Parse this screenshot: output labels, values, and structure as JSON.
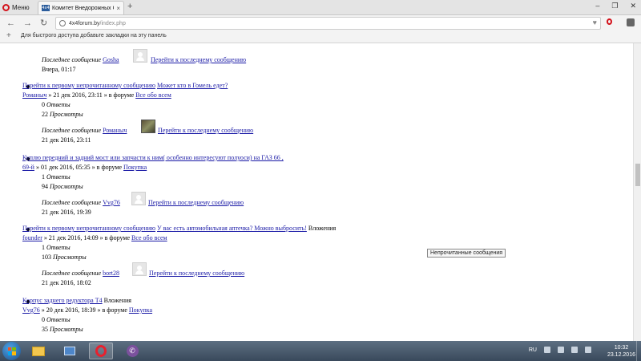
{
  "browser": {
    "menu_label": "Меню",
    "tab_title": "Комитет Внедорожных Сп",
    "tab_favicon": "4x4",
    "url_domain": "4x4forum.by",
    "url_path": "/index.php",
    "bookmarks_hint": "Для быстрого доступа добавьте закладки на эту панель"
  },
  "labels": {
    "last_post": "Последнее сообщение",
    "goto_last": "Перейти к последнему сообщению",
    "goto_unread": "Перейти к первому непрочитанному сообщению",
    "in_forum": "» в форуме",
    "replies": "Ответы",
    "views": "Просмотры",
    "attachments": "Вложения",
    "by_sep": "»"
  },
  "topics": [
    {
      "last_user": "Gosha",
      "last_time": "Вчера, 01:17"
    },
    {
      "title": "Может кто в Гомель едет?",
      "author": "Романыч",
      "date": "21 дек 2016, 23:11",
      "forum": "Все обо всем",
      "replies": "0",
      "views": "22",
      "last_user": "Романыч",
      "last_time": "21 дек 2016, 23:11"
    },
    {
      "title_line1": "Куплю передний и задний мост или запчасти к ним( особенно интересуют полуоси) на ГАЗ 66 ,",
      "title_line2": "69-й",
      "rest": "» 01 дек 2016, 05:35 » в форуме",
      "forum": "Покупка",
      "replies": "1",
      "views": "94",
      "last_user": "Vvg76",
      "last_time": "21 дек 2016, 19:39"
    },
    {
      "title": "У вас есть автомобильная аптечка? Можно выбросить!",
      "author": "founder",
      "date": "21 дек 2016, 14:09",
      "forum": "Все обо всем",
      "replies": "1",
      "views": "103",
      "last_user": "bort28",
      "last_time": "21 дек 2016, 18:02"
    },
    {
      "title": "Корпус заднего редуктора Т4",
      "author": "Vvg76",
      "date": "20 дек 2016, 18:39",
      "forum": "Покупка",
      "replies": "0",
      "views": "35"
    }
  ],
  "tooltip": "Непрочитанные сообщения",
  "taskbar": {
    "lang": "RU",
    "time": "10:32",
    "date": "23.12.2016"
  },
  "colors": {
    "link": "#1a1aa6",
    "opera_red": "#d3111a"
  }
}
